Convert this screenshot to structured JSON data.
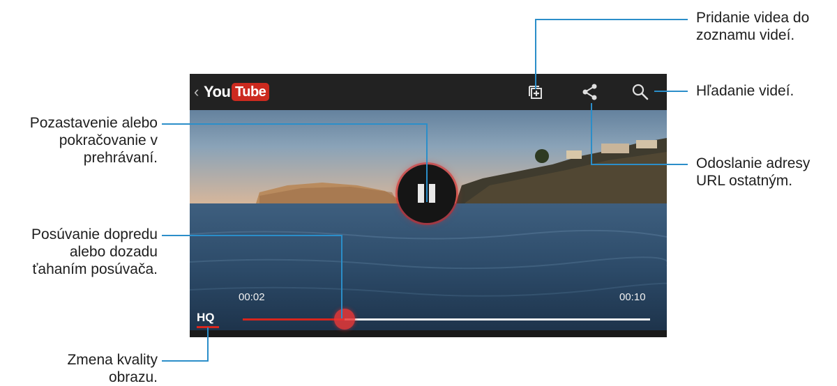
{
  "app": {
    "logo_you": "You",
    "logo_tube": "Tube",
    "back_icon": "chevron-left-icon"
  },
  "toolbar": {
    "icons": [
      "add-to-playlist-icon",
      "share-icon",
      "search-icon"
    ]
  },
  "player": {
    "pause_icon": "pause-icon",
    "time_elapsed": "00:02",
    "time_total": "00:10",
    "progress_fraction": 0.25,
    "quality_label": "HQ",
    "colors": {
      "accent": "#d8261d",
      "topbar": "#222222",
      "track": "#f0f0f0"
    }
  },
  "callouts": {
    "add_to_playlist": [
      "Pridanie videa do",
      "zoznamu videí."
    ],
    "search": [
      "Hľadanie videí."
    ],
    "share": [
      "Odoslanie adresy",
      "URL ostatným."
    ],
    "pause": [
      "Pozastavenie alebo",
      "pokračovanie v",
      "prehrávaní."
    ],
    "seek": [
      "Posúvanie dopredu",
      "alebo dozadu",
      "ťahaním posúvača."
    ],
    "quality": [
      "Zmena kvality",
      "obrazu."
    ]
  }
}
